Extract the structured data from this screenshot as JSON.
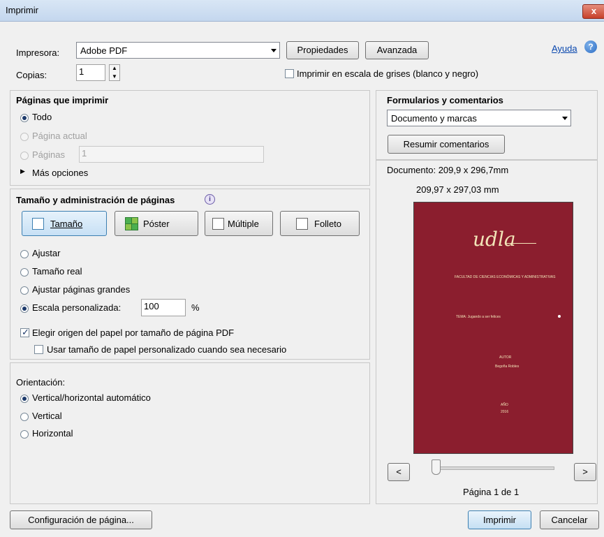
{
  "window": {
    "title": "Imprimir",
    "close": "x"
  },
  "printer": {
    "label": "Impresora:",
    "value": "Adobe PDF",
    "properties": "Propiedades",
    "advanced": "Avanzada"
  },
  "help": {
    "label": "Ayuda",
    "icon": "?"
  },
  "copies": {
    "label": "Copias:",
    "value": "1"
  },
  "grayscale": {
    "label": "Imprimir en escala de grises (blanco y negro)",
    "checked": false
  },
  "pages": {
    "heading": "Páginas que imprimir",
    "all": "Todo",
    "current": "Página actual",
    "range": "Páginas",
    "range_value": "1",
    "more": "Más opciones"
  },
  "sizing": {
    "heading": "Tamaño y administración de páginas",
    "info_icon": "i",
    "tabs": {
      "size": "Tamaño",
      "poster": "Póster",
      "multiple": "Múltiple",
      "booklet": "Folleto"
    },
    "fit": "Ajustar",
    "actual": "Tamaño real",
    "shrink": "Ajustar páginas grandes",
    "custom": "Escala personalizada:",
    "custom_value": "100",
    "percent": "%",
    "paper_source": "Elegir origen del papel por tamaño de página PDF",
    "custom_paper": "Usar tamaño de papel personalizado cuando sea necesario"
  },
  "orientation": {
    "heading": "Orientación:",
    "auto": "Vertical/horizontal automático",
    "portrait": "Vertical",
    "landscape": "Horizontal"
  },
  "forms": {
    "heading": "Formularios y comentarios",
    "value": "Documento y marcas",
    "summarize": "Resumir comentarios"
  },
  "preview": {
    "document_size": "Documento: 209,9 x 296,7mm",
    "paper_size": "209,97 x 297,03 mm",
    "logo": "udla",
    "faculty": "FACULTAD DE CIENCIAS ECONÓMICAS Y ADMINISTRATIVAS",
    "tema": "TEMA: Jugando a ser felices",
    "autor_label": "AUTOR",
    "autor": "Begoña Robles",
    "ano_label": "AÑO",
    "ano": "2016",
    "prev": "<",
    "next": ">",
    "page_label": "Página 1 de 1",
    "colors": {
      "page": "#8b1e2e",
      "text": "#f2e5b8"
    }
  },
  "footer": {
    "page_setup": "Configuración de página...",
    "print": "Imprimir",
    "cancel": "Cancelar"
  }
}
